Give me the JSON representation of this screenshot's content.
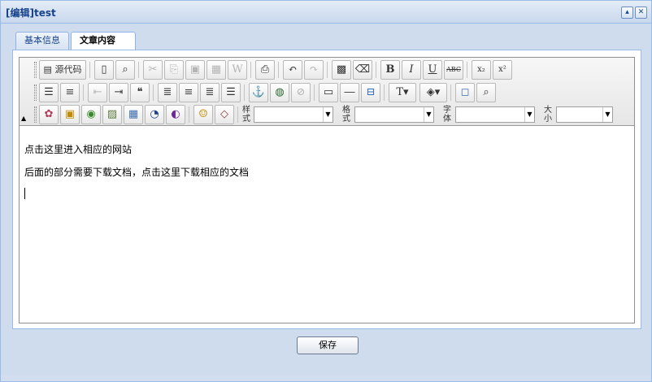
{
  "window": {
    "title": "[编辑]test",
    "collapse_icon": "▴",
    "close_icon": "✕"
  },
  "tabs": [
    {
      "label": "基本信息"
    },
    {
      "label": "文章内容"
    }
  ],
  "toolbar": {
    "source_label": "源代码",
    "style_label": "样式",
    "format_label": "格式",
    "font_label": "字体",
    "size_label": "大小",
    "buttons": {
      "bold": "B",
      "italic": "I",
      "underline": "U",
      "strike": "ABC",
      "subscript": "x₂",
      "superscript": "x²",
      "blockquote": "❝"
    }
  },
  "content": {
    "line1": "点击这里进入相应的网站",
    "line2": "后面的部分需要下载文档，点击这里下载相应的文档"
  },
  "footer": {
    "save_label": "保存"
  }
}
